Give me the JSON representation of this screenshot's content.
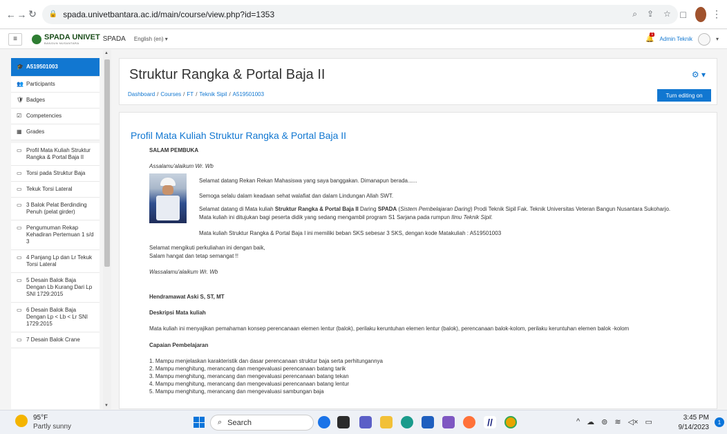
{
  "browser": {
    "url": "spada.univetbantara.ac.id/main/course/view.php?id=1353"
  },
  "navbar": {
    "logo_text": "SPADA UNIVET",
    "logo_sub": "BANGUN NUSANTARA",
    "site_name": "SPADA",
    "language": "English (en) ▾",
    "notification_count": "1",
    "user_name": "Admin Teknik"
  },
  "sidebar": {
    "items": [
      {
        "label": "A519501003",
        "icon": "graduation-cap-icon",
        "glyph": "🎓"
      },
      {
        "label": "Participants",
        "icon": "users-icon",
        "glyph": "👥"
      },
      {
        "label": "Badges",
        "icon": "shield-icon",
        "glyph": "🛡"
      },
      {
        "label": "Competencies",
        "icon": "checkbox-icon",
        "glyph": "☑"
      },
      {
        "label": "Grades",
        "icon": "table-icon",
        "glyph": "▦"
      },
      {
        "label": "Profil Mata Kuliah Struktur Rangka & Portal Baja II",
        "icon": "folder-icon",
        "glyph": "▭"
      },
      {
        "label": "Torsi pada Struktur Baja",
        "icon": "folder-icon",
        "glyph": "▭"
      },
      {
        "label": "Tekuk Torsi Lateral",
        "icon": "folder-icon",
        "glyph": "▭"
      },
      {
        "label": "3 Balok Pelat Berdinding Penuh (pelat girder)",
        "icon": "folder-icon",
        "glyph": "▭"
      },
      {
        "label": "Pengumuman Rekap Kehadiran Pertemuan 1 s/d 3",
        "icon": "folder-icon",
        "glyph": "▭"
      },
      {
        "label": "4 Panjang Lp dan Lr Tekuk Torsi Lateral",
        "icon": "folder-icon",
        "glyph": "▭"
      },
      {
        "label": "5 Desain Balok Baja Dengan Lb Kurang Dari Lp SNI 1729:2015",
        "icon": "folder-icon",
        "glyph": "▭"
      },
      {
        "label": "6 Desain Balok Baja Dengan Lp < Lb < Lr SNI 1729:2015",
        "icon": "folder-icon",
        "glyph": "▭"
      },
      {
        "label": "7 Desain Balok Crane",
        "icon": "folder-icon",
        "glyph": "▭"
      }
    ]
  },
  "header": {
    "title": "Struktur Rangka & Portal Baja II",
    "breadcrumb": [
      "Dashboard",
      "Courses",
      "FT",
      "Teknik Sipil",
      "A519501003"
    ],
    "edit_button": "Turn editing on"
  },
  "content": {
    "section_title": "Profil Mata Kuliah Struktur Rangka & Portal Baja II",
    "salam_heading": "SALAM PEMBUKA",
    "greeting": "Assalamu'alaikum Wr. Wb",
    "p1": "Selamat datang Rekan Rekan Mahasiswa yang saya banggakan. Dimanapun berada......",
    "p2": "Semoga selalu dalam keadaan sehat walafiat dan dalam Lindungan Allah SWT.",
    "p3_a": "Selamat datang di Mata kuliah ",
    "p3_b": "Struktur Rangka & Portal Baja II",
    "p3_c": " Daring ",
    "p3_d": "SPADA",
    "p3_e": " (",
    "p3_f": "Sistem Pembelajaran Daring",
    "p3_g": ") Prodi Teknik Sipil Fak. Teknik Universitas Veteran Bangun Nusantara Sukoharjo.",
    "p4_a": "Mata kuliah ini ditujukan bagi peserta didik yang sedang mengambil program S1 Sarjana pada rumpun ",
    "p4_b": "Ilmu Teknik Sipil.",
    "p5": "Mata kuliah Struktur Rangka & Portal Baja I ini memiliki beban SKS sebesar 3 SKS, dengan kode Matakuliah : A519501003",
    "p6": "Selamat mengikuti perkuliahan ini dengan baik,",
    "p7": "Salam hangat dan tetap semangat !!",
    "closing": "Wassalamu'alaikum Wr. Wb",
    "author": "Hendramawat Aski S, ST, MT",
    "desc_heading": "Deskripsi Mata kuliah",
    "desc_text": "Mata kuliah ini menyajikan pemahaman konsep perencanaan elemen lentur (balok), perilaku keruntuhan elemen lentur (balok), perencanaan balok-kolom, perilaku keruntuhan elemen balok -kolom",
    "capaian_heading": "Capaian Pembelajaran",
    "capaian": [
      "1. Mampu menjelaskan karakteristik dan dasar perencanaan struktur baja serta perhitungannya",
      "2. Mampu menghitung, merancang dan mengevaluasi perencanaan batang tarik",
      "3. Mampu menghitung, merancang dan mengevaluasi perencanaan batang tekan",
      "4. Mampu menghitung, merancang dan mengevaluasi perencanaan batang lentur",
      "5. Mampu menghitung, merancang dan mengevaluasi sambungan baja"
    ]
  },
  "taskbar": {
    "temperature": "95°F",
    "weather": "Partly sunny",
    "search_label": "Search",
    "time": "3:45 PM",
    "date": "9/14/2023",
    "notification_count": "1"
  }
}
